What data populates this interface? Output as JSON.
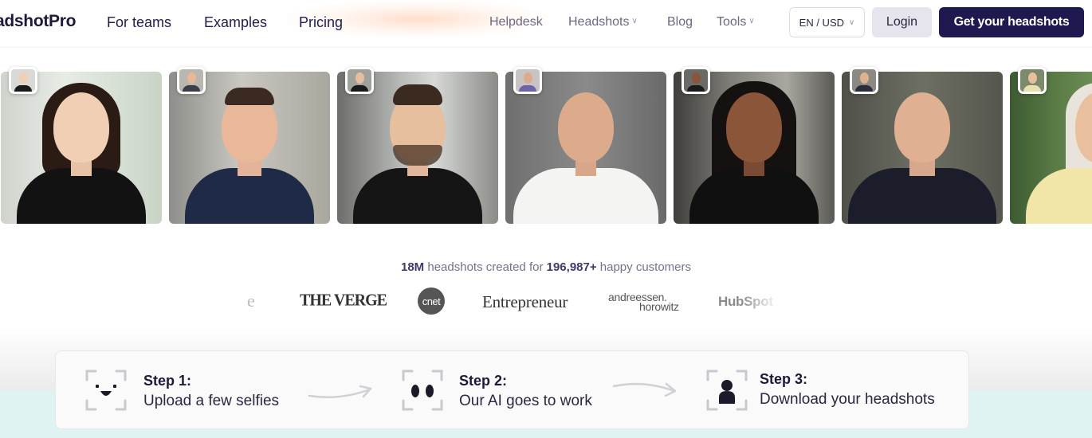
{
  "brand": {
    "logo_text": "adshotPro"
  },
  "nav": {
    "main": [
      {
        "label": "For teams"
      },
      {
        "label": "Examples"
      },
      {
        "label": "Pricing"
      }
    ],
    "secondary": [
      {
        "label": "Helpdesk"
      },
      {
        "label": "Headshots"
      },
      {
        "label": "Blog"
      },
      {
        "label": "Tools"
      }
    ],
    "lang_label": "EN / USD",
    "login_label": "Login",
    "cta_label": "Get your headshots"
  },
  "stats": {
    "headshots": "18M",
    "middle": " headshots created for ",
    "customers": "196,987+",
    "end": " happy customers"
  },
  "press_logos": [
    {
      "name": "e"
    },
    {
      "name": "THE VERGE"
    },
    {
      "name": "cnet"
    },
    {
      "name": "Entrepreneur"
    },
    {
      "name": "andreessen."
    },
    {
      "name": "horowitz"
    },
    {
      "name": "HubSpot"
    }
  ],
  "steps": [
    {
      "title": "Step 1:",
      "desc": "Upload a few selfies"
    },
    {
      "title": "Step 2:",
      "desc": "Our AI goes to work"
    },
    {
      "title": "Step 3:",
      "desc": "Download your headshots"
    }
  ],
  "colors": {
    "brand_navy": "#1e1a4f",
    "mint": "#dff3f3"
  }
}
